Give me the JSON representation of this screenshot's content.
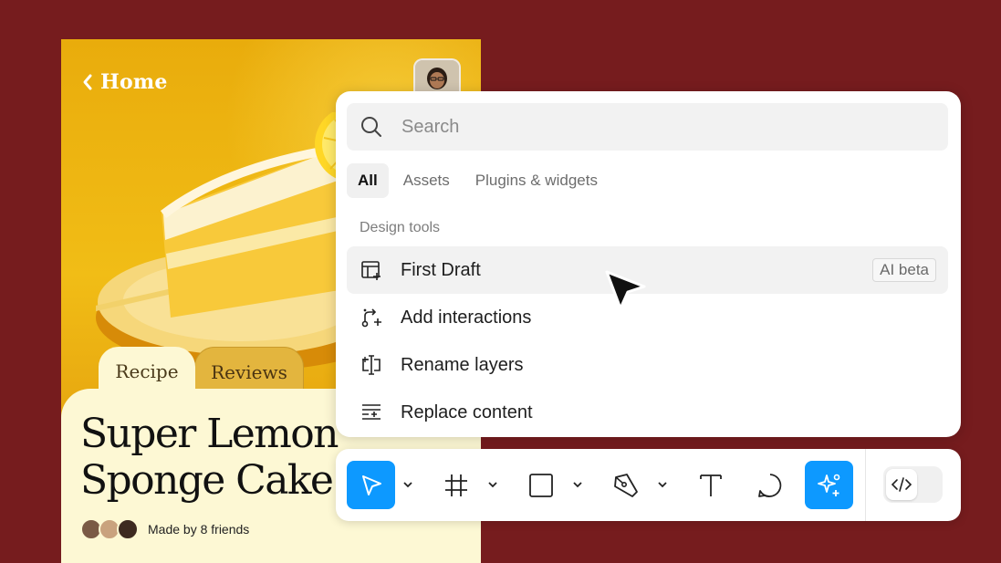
{
  "card": {
    "nav_label": "Home",
    "tabs": [
      {
        "label": "Recipe",
        "active": true
      },
      {
        "label": "Reviews",
        "active": false
      }
    ],
    "title_line1": "Super Lemon",
    "title_line2": "Sponge Cake",
    "made_by": "Made by 8 friends"
  },
  "panel": {
    "search_placeholder": "Search",
    "filter_tabs": [
      {
        "label": "All",
        "active": true
      },
      {
        "label": "Assets",
        "active": false
      },
      {
        "label": "Plugins & widgets",
        "active": false
      }
    ],
    "section_label": "Design tools",
    "items": [
      {
        "label": "First Draft",
        "icon": "layout-plus-icon",
        "badge": "AI beta",
        "hover": true
      },
      {
        "label": "Add interactions",
        "icon": "interactions-icon"
      },
      {
        "label": "Rename layers",
        "icon": "rename-icon"
      },
      {
        "label": "Replace content",
        "icon": "replace-content-icon"
      }
    ]
  },
  "toolbar": {
    "tools": [
      "move-icon",
      "frame-icon",
      "rectangle-icon",
      "pen-icon",
      "text-icon",
      "comment-icon",
      "ai-sparkle-icon"
    ],
    "active_tools": [
      "move-icon",
      "ai-sparkle-icon"
    ],
    "code_toggle": "code-icon"
  },
  "colors": {
    "background": "#761c1e",
    "accent": "#0d99ff",
    "card_cream": "#fdf8d4",
    "card_yellow": "#efb714"
  }
}
